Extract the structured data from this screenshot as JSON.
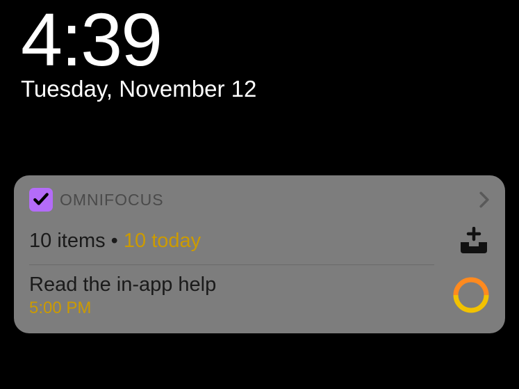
{
  "clock": {
    "time": "4:39",
    "date": "Tuesday, November 12"
  },
  "widget": {
    "app_name": "OMNIFOCUS",
    "summary": {
      "items_label": "10 items",
      "separator": " • ",
      "today_label": "10 today"
    },
    "task": {
      "title": "Read the in-app help",
      "time": "5:00 PM"
    },
    "icons": {
      "app": "checkmark-icon",
      "chevron": "chevron-right-icon",
      "inbox": "inbox-plus-icon",
      "circle": "task-circle-icon"
    },
    "colors": {
      "app_icon_bg": "#b46cf9",
      "today_color": "#cc9b00",
      "circle_top": "#ff8a1f",
      "circle_bottom": "#f2c200"
    }
  }
}
